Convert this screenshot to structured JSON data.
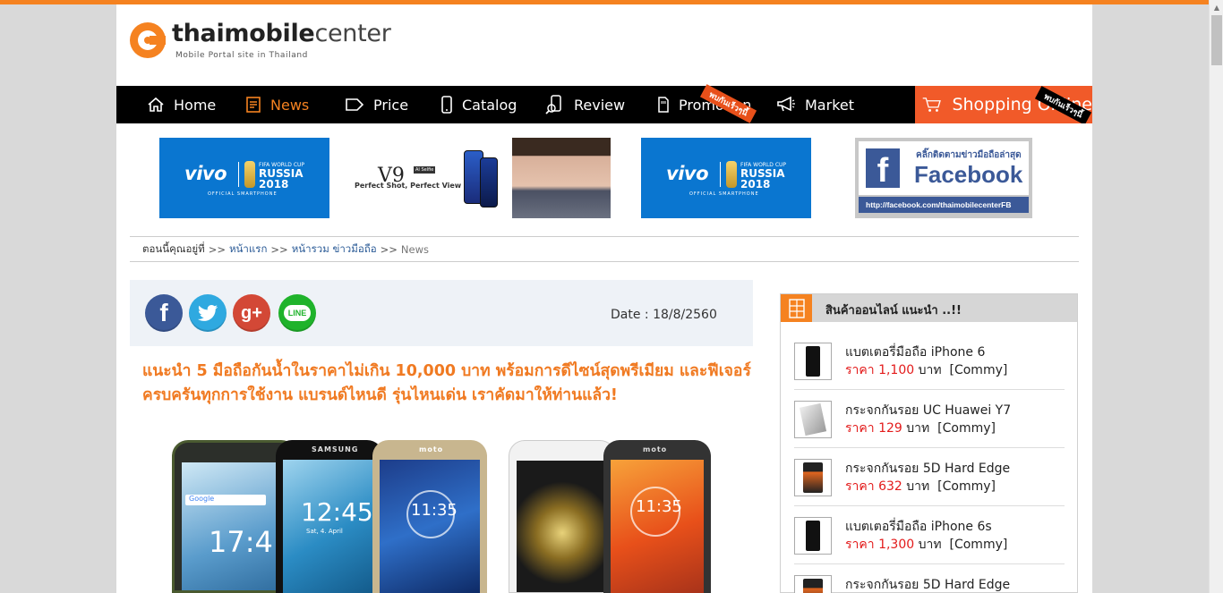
{
  "logo": {
    "name_a": "thaimobile",
    "name_b": "center",
    "tagline": "Mobile Portal site in Thailand"
  },
  "nav": {
    "items": [
      {
        "label": "Home",
        "icon": "home-icon"
      },
      {
        "label": "News",
        "icon": "news-icon",
        "active": true
      },
      {
        "label": "Price",
        "icon": "tag-icon"
      },
      {
        "label": "Catalog",
        "icon": "phone-icon"
      },
      {
        "label": "Review",
        "icon": "review-icon"
      },
      {
        "label": "Promotion",
        "icon": "sim-icon",
        "badge": "พบกันเร็วๆนี้"
      },
      {
        "label": "Market",
        "icon": "megaphone-icon"
      }
    ],
    "shopping": {
      "label": "Shopping Online",
      "icon": "cart-icon",
      "badge": "พบกันเร็วๆนี้"
    }
  },
  "banners": {
    "vivo": {
      "brand": "vivo",
      "fifa": "FIFA WORLD CUP",
      "russia": "RUSSIA",
      "year": "2018",
      "official": "OFFICIAL SMARTPHONE"
    },
    "v9": {
      "model": "V9",
      "badge": "AI Selfie",
      "tagline": "Perfect Shot, Perfect View"
    },
    "facebook": {
      "small": "คลิ๊กติดตามข่าวมือถือล่าสุด",
      "big": "Facebook",
      "url": "http://facebook.com/thaimobilecenterFB",
      "letter": "f"
    }
  },
  "breadcrumb": {
    "prefix": "ตอนนี้คุณอยู่ที่",
    "sep": ">>",
    "items": [
      "หน้าแรก",
      "หน้ารวม ข่าวมือถือ"
    ],
    "current": "News"
  },
  "share": {
    "facebook": "f",
    "twitter": "t",
    "google": "g+",
    "line": "LINE"
  },
  "article": {
    "date": "Date : 18/8/2560",
    "headline": "แนะนำ 5 มือถือกันน้ำในราคาไม่เกิน 10,000 บาท พร้อมการดีไซน์สุดพรีเมียม และฟีเจอร์ครบครันทุกการใช้งาน แบรนด์ไหนดี รุ่นไหนเด่น เราคัดมาให้ท่านแล้ว!",
    "hero": {
      "brand2": "SAMSUNG",
      "brand3": "moto",
      "brand5": "moto",
      "time1": "17:4",
      "time2": "12:45",
      "time3": "11:35",
      "time5": "11:35",
      "search": "Google",
      "date2": "Sat, 4. April"
    }
  },
  "sidebar": {
    "title": "สินค้าออนไลน์ แนะนำ ..!!",
    "price_label": "ราคา",
    "currency": "บาท",
    "products": [
      {
        "name": "แบตเตอรี่มือถือ iPhone 6",
        "price": "1,100",
        "shop": "[Commy]"
      },
      {
        "name": "กระจกกันรอย UC Huawei Y7",
        "price": "129",
        "shop": "[Commy]"
      },
      {
        "name": "กระจกกันรอย 5D Hard Edge",
        "price": "632",
        "shop": "[Commy]"
      },
      {
        "name": "แบตเตอรี่มือถือ iPhone 6s",
        "price": "1,300",
        "shop": "[Commy]"
      },
      {
        "name": "กระจกกันรอย 5D Hard Edge",
        "price": "",
        "shop": ""
      }
    ]
  },
  "colors": {
    "accent": "#f58220",
    "headline": "#f07a22",
    "price": "#e31b1b",
    "nav_bg": "#000000",
    "shopping_bg": "#f15a29"
  }
}
